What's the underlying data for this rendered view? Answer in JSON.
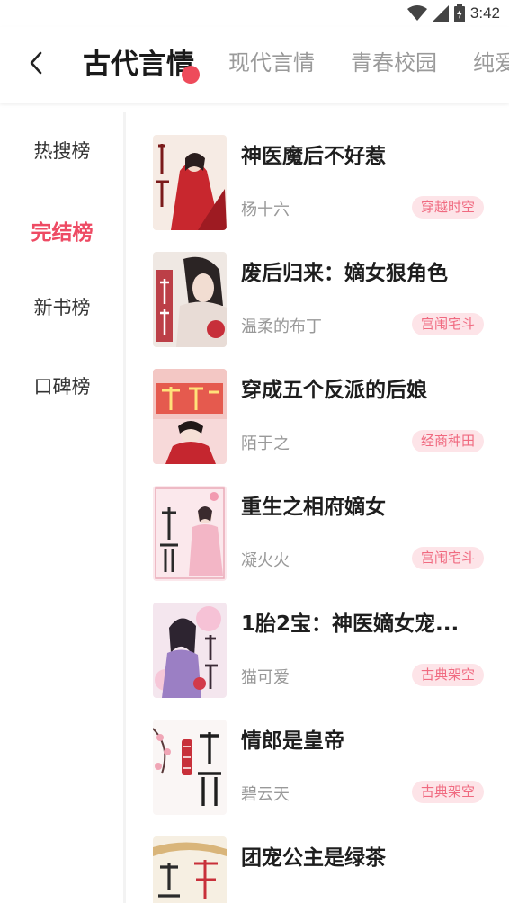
{
  "status_bar": {
    "time": "3:42",
    "icons": [
      "wifi-icon",
      "signal-icon",
      "battery-icon"
    ]
  },
  "header": {
    "back_icon": "chevron-left-icon",
    "tabs": [
      {
        "label": "古代言情",
        "active": true
      },
      {
        "label": "现代言情",
        "active": false
      },
      {
        "label": "青春校园",
        "active": false
      },
      {
        "label": "纯爱",
        "active": false
      }
    ]
  },
  "sidebar": {
    "items": [
      {
        "label": "热搜榜",
        "active": false
      },
      {
        "label": "完结榜",
        "active": true
      },
      {
        "label": "新书榜",
        "active": false
      },
      {
        "label": "口碑榜",
        "active": false
      }
    ]
  },
  "books": [
    {
      "title": "神医魔后不好惹",
      "author": "杨十六",
      "tag": "穿越时空"
    },
    {
      "title": "废后归来：嫡女狠角色",
      "author": "温柔的布丁",
      "tag": "宫闱宅斗"
    },
    {
      "title": "穿成五个反派的后娘",
      "author": "陌于之",
      "tag": "经商种田"
    },
    {
      "title": "重生之相府嫡女",
      "author": "凝火火",
      "tag": "宫闱宅斗"
    },
    {
      "title": "1胎2宝：神医嫡女宠...",
      "author": "猫可爱",
      "tag": "古典架空"
    },
    {
      "title": "情郎是皇帝",
      "author": "碧云天",
      "tag": "古典架空"
    },
    {
      "title": "团宠公主是绿茶",
      "author": "",
      "tag": ""
    }
  ],
  "colors": {
    "accent": "#ee4b64",
    "tag_bg": "#fde4e8",
    "tag_text": "#f06a80"
  }
}
